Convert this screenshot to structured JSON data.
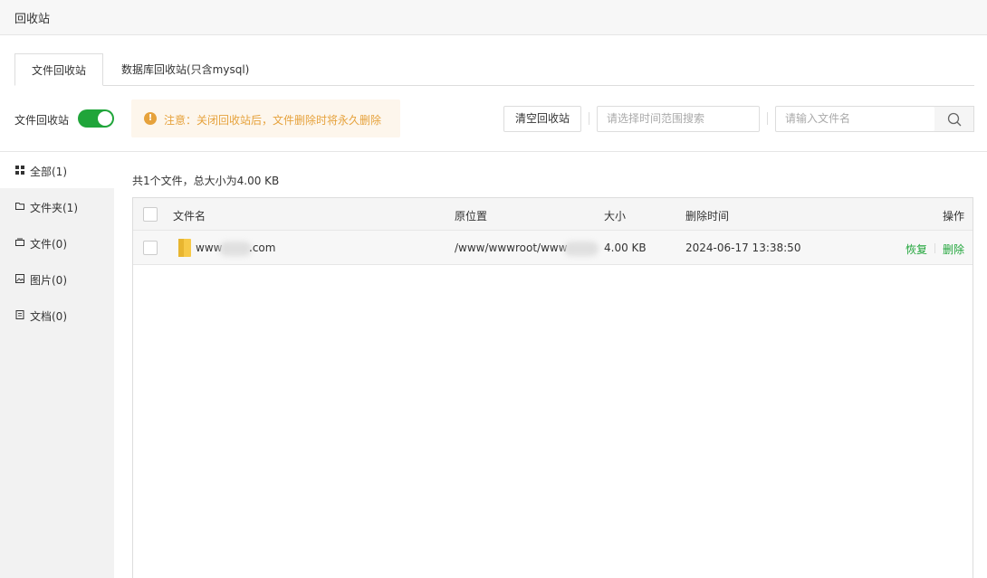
{
  "window": {
    "title": "回收站"
  },
  "tabs": [
    {
      "label": "文件回收站",
      "active": true
    },
    {
      "label": "数据库回收站(只含mysql)",
      "active": false
    }
  ],
  "toolbar": {
    "toggle_label": "文件回收站",
    "toggle_on": true,
    "notice": "注意：关闭回收站后，文件删除时将永久删除",
    "clear_button": "清空回收站",
    "time_range_placeholder": "请选择时间范围搜索",
    "filename_placeholder": "请输入文件名"
  },
  "sidebar": {
    "items": [
      {
        "label": "全部(1)",
        "icon": "grid-icon",
        "active": true
      },
      {
        "label": "文件夹(1)",
        "icon": "folder-outline-icon",
        "active": false
      },
      {
        "label": "文件(0)",
        "icon": "file-icon",
        "active": false
      },
      {
        "label": "图片(0)",
        "icon": "image-icon",
        "active": false
      },
      {
        "label": "文档(0)",
        "icon": "document-icon",
        "active": false
      }
    ]
  },
  "summary": "共1个文件，总大小为4.00 KB",
  "table": {
    "columns": [
      "文件名",
      "原位置",
      "大小",
      "删除时间",
      "操作"
    ],
    "rows": [
      {
        "name": "www",
        "name_suffix": ".com",
        "location": "/www/wwwroot/www",
        "size": "4.00 KB",
        "deleted_at": "2024-06-17 13:38:50",
        "actions": [
          "恢复",
          "删除"
        ]
      }
    ]
  },
  "colors": {
    "accent_green": "#20a53a",
    "warning_orange": "#e6a23c",
    "warning_bg": "#fdf6ec"
  }
}
